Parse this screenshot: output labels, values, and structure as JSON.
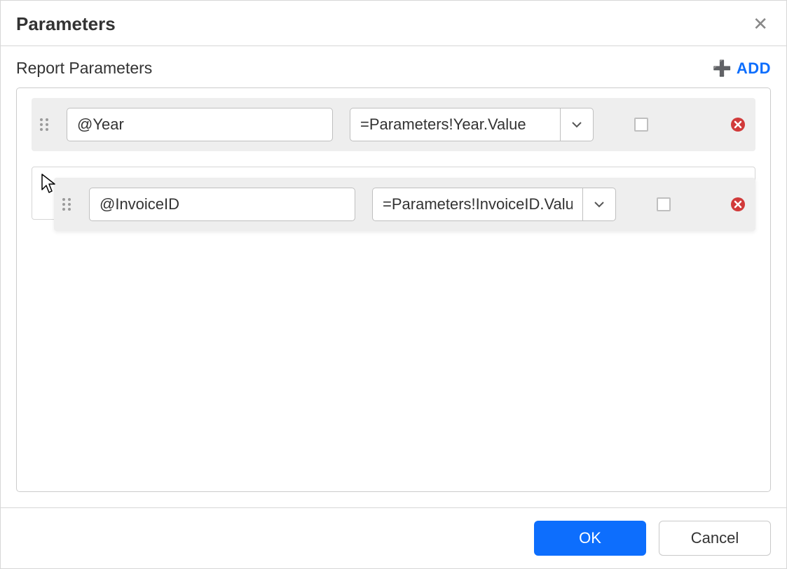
{
  "dialog": {
    "title": "Parameters",
    "close_label": "Close"
  },
  "section": {
    "title": "Report Parameters",
    "add_label": "ADD"
  },
  "rows": [
    {
      "name": "@Year",
      "value": "=Parameters!Year.Value",
      "checked": false
    },
    {
      "name": "@InvoiceID",
      "value": "=Parameters!InvoiceID.Value",
      "checked": false
    }
  ],
  "footer": {
    "ok": "OK",
    "cancel": "Cancel"
  }
}
